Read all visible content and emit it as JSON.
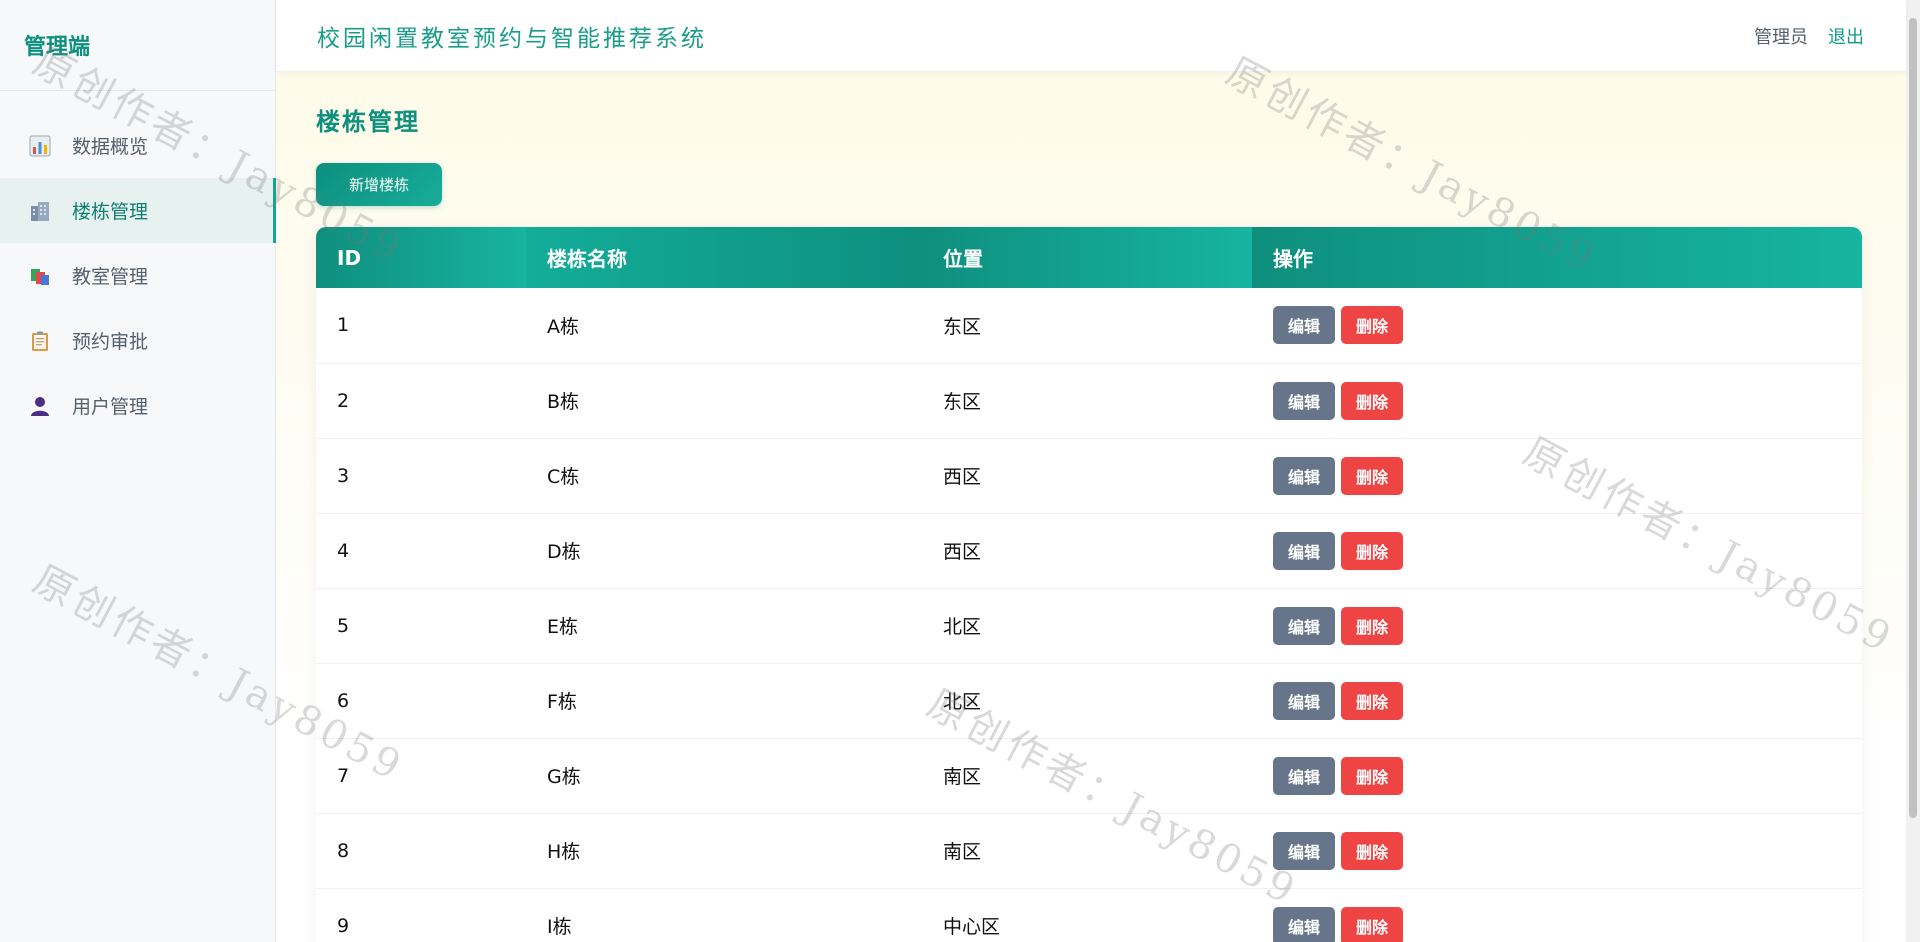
{
  "sidebar": {
    "brand": "管理端",
    "items": [
      {
        "label": "数据概览",
        "icon": "bar-chart-icon"
      },
      {
        "label": "楼栋管理",
        "icon": "building-icon",
        "active": true
      },
      {
        "label": "教室管理",
        "icon": "books-icon"
      },
      {
        "label": "预约审批",
        "icon": "clipboard-icon"
      },
      {
        "label": "用户管理",
        "icon": "user-icon"
      }
    ]
  },
  "header": {
    "title": "校园闲置教室预约与智能推荐系统",
    "admin_label": "管理员",
    "logout_label": "退出"
  },
  "main": {
    "page_title": "楼栋管理",
    "add_button_label": "新增楼栋",
    "table": {
      "columns": [
        "ID",
        "楼栋名称",
        "位置",
        "操作"
      ],
      "edit_label": "编辑",
      "delete_label": "删除",
      "rows": [
        {
          "id": "1",
          "name": "A栋",
          "location": "东区"
        },
        {
          "id": "2",
          "name": "B栋",
          "location": "东区"
        },
        {
          "id": "3",
          "name": "C栋",
          "location": "西区"
        },
        {
          "id": "4",
          "name": "D栋",
          "location": "西区"
        },
        {
          "id": "5",
          "name": "E栋",
          "location": "北区"
        },
        {
          "id": "6",
          "name": "F栋",
          "location": "北区"
        },
        {
          "id": "7",
          "name": "G栋",
          "location": "南区"
        },
        {
          "id": "8",
          "name": "H栋",
          "location": "南区"
        },
        {
          "id": "9",
          "name": "I栋",
          "location": "中心区"
        }
      ]
    }
  },
  "watermark": "原创作者：Jay8059",
  "colors": {
    "primary": "#0f8f7d",
    "edit": "#66758a",
    "delete": "#ee4444"
  }
}
